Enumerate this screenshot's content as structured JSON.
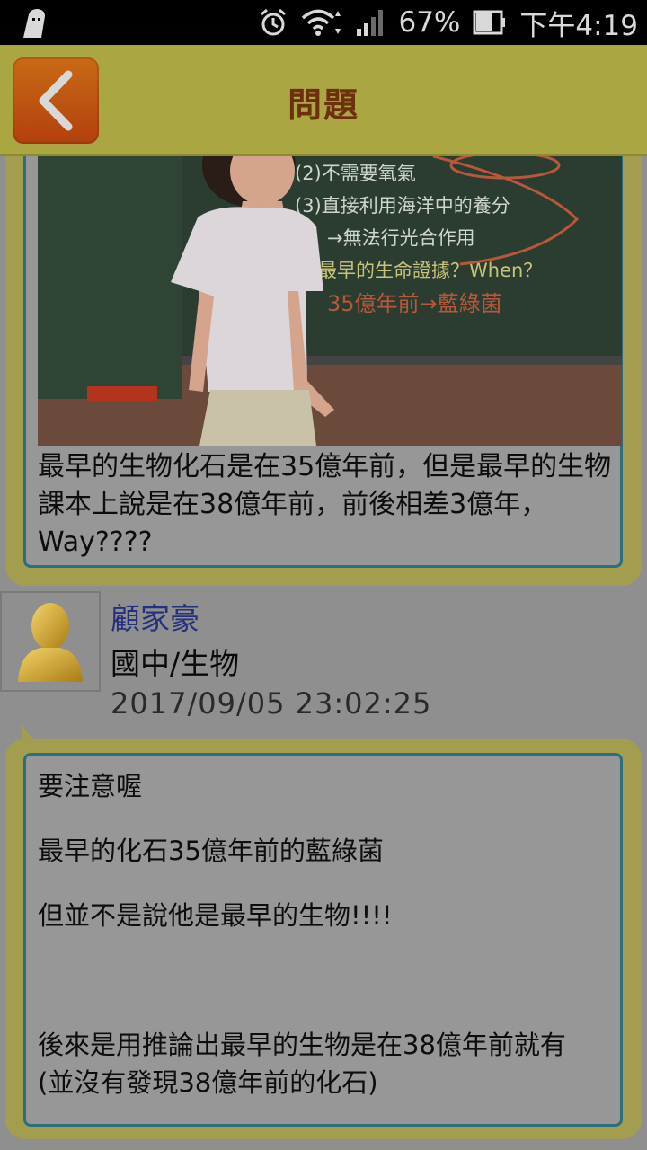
{
  "status_bar": {
    "battery_percent": "67%",
    "time": "下午4:19"
  },
  "header": {
    "title": "問題"
  },
  "question": {
    "photo_board_lines": [
      "(2)不需要氧氣",
      "(3)直接利用海洋中的養分",
      "→無法行光合作用",
      "最早的生命證據？When？"
    ],
    "photo_handwriting": "35億年前→藍綠菌",
    "text": "最早的生物化石是在35億年前，但是最早的生物課本上說是在38億年前，前後相差3億年，Way????"
  },
  "answer": {
    "author_name": "顧家豪",
    "category": "國中/生物",
    "timestamp": "2017/09/05 23:02:25",
    "lines": [
      "要注意喔",
      "最早的化石35億年前的藍綠菌",
      "但並不是說他是最早的生物!!!!",
      "後來是用推論出最早的生物是在38億年前就有 (並沒有發現38億年前的化石)"
    ]
  },
  "colors": {
    "header_bg": "#aaa642",
    "back_button": "#c0550f",
    "bubble_border": "#a39d50",
    "inner_border": "#2d6e7d",
    "author_name": "#23307e"
  },
  "icons": {
    "status_left": "ghost-icon",
    "alarm": "alarm-icon",
    "wifi": "wifi-icon",
    "signal": "signal-icon",
    "battery": "battery-icon",
    "back": "chevron-left-icon",
    "avatar": "user-silhouette-icon"
  }
}
